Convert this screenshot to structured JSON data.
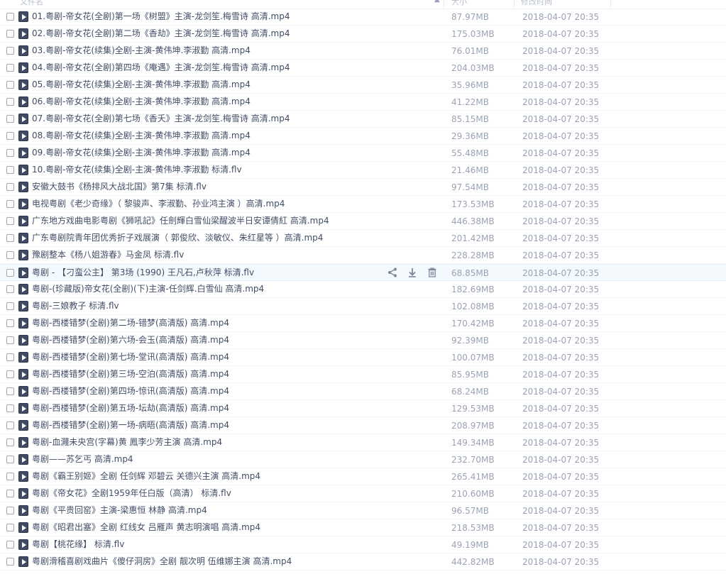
{
  "header": {
    "name": "文件名",
    "size": "大小",
    "time": "修改时间"
  },
  "files": [
    {
      "name": "01.粤剧-帝女花(全剧)第一场《树盟》主演-龙剑笙.梅雪诗 高清.mp4",
      "size": "87.97MB",
      "date": "2018-04-07 20:35"
    },
    {
      "name": "02.粤剧-帝女花(全剧)第二场《香劫》主演-龙剑笙.梅雪诗 高清.mp4",
      "size": "175.03MB",
      "date": "2018-04-07 20:35"
    },
    {
      "name": "03.粤剧-帝女花(续集)全剧-主演-黄伟坤.李淑勤 高清.mp4",
      "size": "76.01MB",
      "date": "2018-04-07 20:35"
    },
    {
      "name": "04.粤剧-帝女花(全剧)第四场《庵遇》主演-龙剑笙.梅雪诗 高清.mp4",
      "size": "204.03MB",
      "date": "2018-04-07 20:35"
    },
    {
      "name": "05.粤剧-帝女花(续集)全剧-主演-黄伟坤.李淑勤 高清.mp4",
      "size": "35.96MB",
      "date": "2018-04-07 20:35"
    },
    {
      "name": "06.粤剧-帝女花(续集)全剧-主演-黄伟坤.李淑勤 高清.mp4",
      "size": "41.22MB",
      "date": "2018-04-07 20:35"
    },
    {
      "name": "07.粤剧-帝女花(全剧)第七场《香夭》主演-龙剑笙.梅雪诗 高清.mp4",
      "size": "85.15MB",
      "date": "2018-04-07 20:35"
    },
    {
      "name": "08.粤剧-帝女花(续集)全剧-主演-黄伟坤.李淑勤 高清.mp4",
      "size": "29.36MB",
      "date": "2018-04-07 20:35"
    },
    {
      "name": "09.粤剧-帝女花(续集)全剧-主演-黄伟坤.李淑勤 高清.mp4",
      "size": "55.48MB",
      "date": "2018-04-07 20:35"
    },
    {
      "name": "10.粤剧-帝女花(续集)全剧-主演-黄伟坤.李淑勤 标清.flv",
      "size": "21.46MB",
      "date": "2018-04-07 20:35"
    },
    {
      "name": "安徽大鼓书《杨排风大战北国》第7集 标清.flv",
      "size": "97.54MB",
      "date": "2018-04-07 20:35"
    },
    {
      "name": "电视粤剧《老少奇缘》（ 黎骏声、李淑勤、孙业鸿主演 ）高清.mp4",
      "size": "173.53MB",
      "date": "2018-04-07 20:35"
    },
    {
      "name": "广东地方戏曲电影粤剧《狮吼記》任劍輝白雪仙梁醒波半日安谭倩紅 高清.mp4",
      "size": "446.38MB",
      "date": "2018-04-07 20:35"
    },
    {
      "name": "广东粤剧院青年团优秀折子戏展演（ 郭俊欣、淡敏仪、朱红星等 ）高清.mp4",
      "size": "201.42MB",
      "date": "2018-04-07 20:35"
    },
    {
      "name": "豫剧整本《杨八姐游春》马金凤 标清.flv",
      "size": "228.28MB",
      "date": "2018-04-07 20:35"
    },
    {
      "name": "粤剧 - 【刁蛮公主】 第3场 (1990) 王凡石,卢秋萍 标清.flv",
      "size": "68.85MB",
      "date": "2018-04-07 20:35"
    },
    {
      "name": "粤剧-(珍藏版)帝女花(全剧)(下)主演-任剑辉.白雪仙 高清.mp4",
      "size": "182.69MB",
      "date": "2018-04-07 20:35"
    },
    {
      "name": "粤剧-三娘教子 标清.flv",
      "size": "102.08MB",
      "date": "2018-04-07 20:35"
    },
    {
      "name": "粤剧-西楼错梦(全剧)第二场-错梦(高清版) 高清.mp4",
      "size": "170.42MB",
      "date": "2018-04-07 20:35"
    },
    {
      "name": "粤剧-西楼错梦(全剧)第六场-会玉(高清版) 高清.mp4",
      "size": "92.39MB",
      "date": "2018-04-07 20:35"
    },
    {
      "name": "粤剧-西楼错梦(全剧)第七场-堂讯(高清版) 高清.mp4",
      "size": "100.07MB",
      "date": "2018-04-07 20:35"
    },
    {
      "name": "粤剧-西楼错梦(全剧)第三场-空泊(高清版) 高清.mp4",
      "size": "85.95MB",
      "date": "2018-04-07 20:35"
    },
    {
      "name": "粤剧-西楼错梦(全剧)第四场-惊讯(高清版) 高清.mp4",
      "size": "68.24MB",
      "date": "2018-04-07 20:35"
    },
    {
      "name": "粤剧-西楼错梦(全剧)第五场-坛劫(高清版) 高清.mp4",
      "size": "129.53MB",
      "date": "2018-04-07 20:35"
    },
    {
      "name": "粤剧-西楼错梦(全剧)第一场-病晤(高清版) 高清.mp4",
      "size": "208.97MB",
      "date": "2018-04-07 20:35"
    },
    {
      "name": "粤剧-血濺未央宫(字幕)黄 鳳李少芳主演 高清.mp4",
      "size": "149.34MB",
      "date": "2018-04-07 20:35"
    },
    {
      "name": "粤剧——苏乞丐 高清.mp4",
      "size": "232.70MB",
      "date": "2018-04-07 20:35"
    },
    {
      "name": "粤剧《霸王别姬》全剧 任剑辉 邓碧云 关德兴主演 高清.mp4",
      "size": "265.41MB",
      "date": "2018-04-07 20:35"
    },
    {
      "name": "粤剧《帝女花》全剧1959年任白版（高清） 标清.flv",
      "size": "210.60MB",
      "date": "2018-04-07 20:35"
    },
    {
      "name": "粤剧《平贵回窑》主演-梁惠恒  林静 高清.mp4",
      "size": "96.57MB",
      "date": "2018-04-07 20:35"
    },
    {
      "name": "粤剧《昭君出塞》全剧 红线女 吕雁声 黄志明演唱 高清.mp4",
      "size": "218.53MB",
      "date": "2018-04-07 20:35"
    },
    {
      "name": "粤剧【桃花缘】 标清.flv",
      "size": "49.19MB",
      "date": "2018-04-07 20:35"
    },
    {
      "name": "粤剧滑稽喜剧戏曲片《傻仔洞房》全剧 靓次明 伍维娜主演 高清.mp4",
      "size": "442.82MB",
      "date": "2018-04-07 20:35"
    }
  ],
  "hover_row": 15,
  "icons": {
    "share": "share-icon",
    "download": "download-icon",
    "delete": "trash-icon",
    "file": "video-file-icon"
  }
}
